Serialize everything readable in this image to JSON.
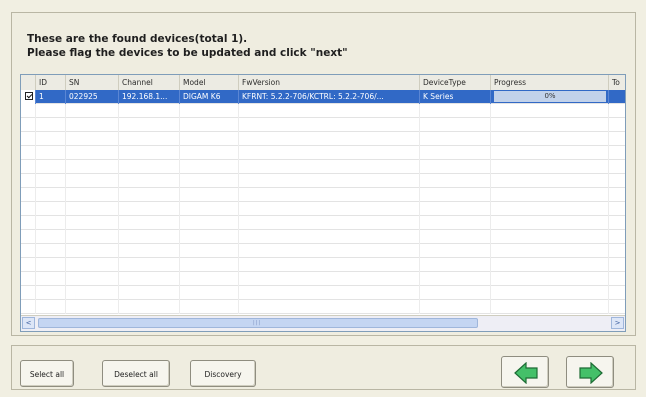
{
  "header": {
    "line1": "These are the found devices(total 1).",
    "line2": "Please flag the devices to be updated and click \"next\""
  },
  "table": {
    "columns": [
      "",
      "ID",
      "SN",
      "Channel",
      "Model",
      "FwVersion",
      "DeviceType",
      "Progress",
      "To"
    ],
    "rows": [
      {
        "checked": true,
        "id": "1",
        "sn": "022925",
        "channel": "192.168.1...",
        "model": "DIGAM K6",
        "fw_version": "KFRNT: 5.2.2-706/KCTRL: 5.2.2-706/...",
        "device_type": "K Series",
        "progress": "0%",
        "progress_value": 0
      }
    ],
    "empty_row_count": 15
  },
  "scrollbar": {
    "left_arrow": "<",
    "right_arrow": ">",
    "grip": "|||"
  },
  "buttons": {
    "select_all": "Select all",
    "deselect_all": "Deselect all",
    "discovery": "Discovery",
    "back_icon": "left-arrow-icon",
    "next_icon": "right-arrow-icon"
  },
  "colors": {
    "selection": "#3169c6",
    "arrow_fill": "#44c069",
    "arrow_stroke": "#1d6b34"
  }
}
